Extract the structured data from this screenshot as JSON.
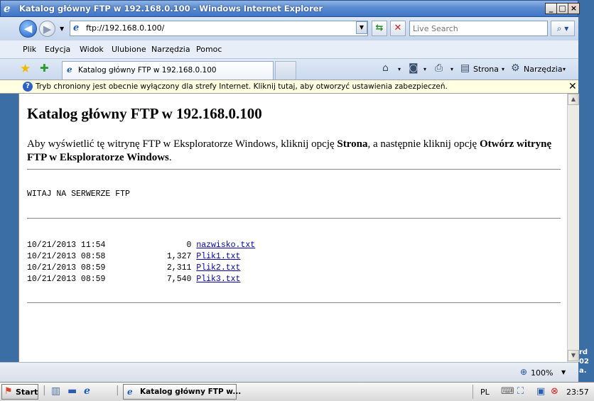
{
  "window": {
    "title": "Katalog główny FTP w 192.168.0.100 - Windows Internet Explorer",
    "min_glyph": "_",
    "max_glyph": "□",
    "close_glyph": "×"
  },
  "nav": {
    "address": "ftp://192.168.0.100/",
    "search_placeholder": "Live Search"
  },
  "menu": {
    "items": [
      "Plik",
      "Edycja",
      "Widok",
      "Ulubione",
      "Narzędzia",
      "Pomoc"
    ]
  },
  "tabs": {
    "active_label": "Katalog główny FTP w 192.168.0.100"
  },
  "commands": {
    "page_label": "Strona",
    "tools_label": "Narzędzia"
  },
  "infobar": {
    "text": "Tryb chroniony jest obecnie wyłączony dla strefy Internet. Kliknij tutaj, aby otworzyć ustawienia zabezpieczeń.",
    "close_glyph": "✕"
  },
  "content": {
    "title": "Katalog główny FTP w 192.168.0.100",
    "intro_part1": "Aby wyświetlić tę witrynę FTP w Eksploratorze Windows, kliknij opcję ",
    "intro_bold1": "Strona",
    "intro_part2": ", a następnie kliknij opcję ",
    "intro_bold2": "Otwórz witrynę FTP w Eksploratorze Windows",
    "intro_part3": ".",
    "welcome": "WITAJ NA SERWERZE FTP",
    "files": [
      {
        "date": "10/21/2013 11:54",
        "size": "0",
        "name": "nazwisko.txt"
      },
      {
        "date": "10/21/2013 08:58",
        "size": "1,327",
        "name": "Plik1.txt"
      },
      {
        "date": "10/21/2013 08:59",
        "size": "2,311",
        "name": "Plik2.txt"
      },
      {
        "date": "10/21/2013 08:59",
        "size": "7,540",
        "name": "Plik3.txt"
      }
    ]
  },
  "status": {
    "zoom": "100%"
  },
  "desktop_sliver": [
    "rd",
    "02",
    "a."
  ],
  "taskbar": {
    "start_label": "Start",
    "task_label": "Katalog główny FTP w...",
    "language": "PL",
    "clock": "23:57"
  },
  "colors": {
    "link": "#0000aa",
    "titlebar": "#3f75c8",
    "infobar": "#ffffe1"
  }
}
